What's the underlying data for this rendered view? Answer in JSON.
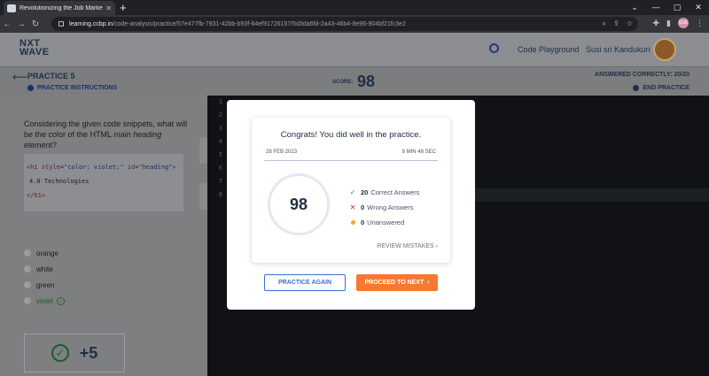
{
  "browser": {
    "tab_title": "Revolutionizing the Job Market |",
    "url_host": "learning.ccbp.in",
    "url_path": "/code-analysis/practice/57e477fb-7931-42bb-b93f-64ef91726157/5d3da6fd-2a43-46b4-8e96-904bf21fc3e2",
    "profile_initials": "SSK"
  },
  "header": {
    "logo_line1": "NXT",
    "logo_line2": "WAVE",
    "code_playground": "Code Playground",
    "user_name": "Susi sri Kandukuri"
  },
  "practice": {
    "title": "PRACTICE 5",
    "instructions_link": "PRACTICE INSTRUCTIONS",
    "score_label": "SCORE:",
    "score_value": "98",
    "answered_correctly": "ANSWERED CORRECTLY: 20/20",
    "end_practice": "END PRACTICE"
  },
  "question": {
    "text_before": "Considering the given code snippets, what will be the color of the HTML ",
    "text_em": "main heading",
    "text_after": " element?",
    "code": {
      "open_tag": "<h1",
      "attr1": "style",
      "attr1_value": "\"color: violet;\"",
      "attr2": "id",
      "attr2_value": "\"heading\"",
      "close_bracket": ">",
      "content": "4.0 Technologies",
      "close_tag": "</h1>"
    },
    "options": [
      "orange",
      "white",
      "green",
      "violet"
    ],
    "correct_option": "violet",
    "points": "+5"
  },
  "editor": {
    "line_numbers": [
      "1",
      "2",
      "3",
      "4",
      "5",
      "6",
      "7",
      "8"
    ]
  },
  "modal": {
    "title": "Congrats! You did well in the practice.",
    "date": "28 FEB 2023",
    "duration": "9 MIN 48 SEC",
    "score": "98",
    "stats": [
      {
        "count": "20",
        "label": "Correct Answers",
        "icon": "check-icon"
      },
      {
        "count": "0",
        "label": "Wrong Answers",
        "icon": "cross-icon"
      },
      {
        "count": "0",
        "label": "Unanswered",
        "icon": "dot-icon"
      }
    ],
    "review_link": "REVIEW MISTAKES",
    "practice_again": "PRACTICE AGAIN",
    "proceed_next": "PROCEED TO NEXT"
  },
  "colors": {
    "accent": "#f7792f",
    "primary_blue": "#3a6fd8",
    "success": "#12a150",
    "error": "#e02424",
    "warning": "#f5a623"
  }
}
